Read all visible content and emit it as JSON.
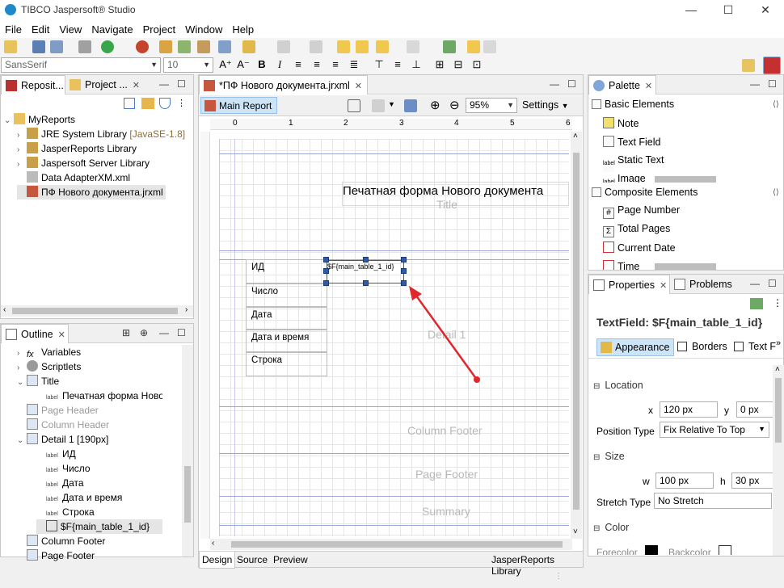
{
  "window": {
    "title": "TIBCO Jaspersoft® Studio",
    "min": "—",
    "max": "☐",
    "close": "✕"
  },
  "menu": [
    "File",
    "Edit",
    "View",
    "Navigate",
    "Project",
    "Window",
    "Help"
  ],
  "format": {
    "font": "SansSerif",
    "size": "10"
  },
  "repo": {
    "tab1": "Reposit...",
    "tab2": "Project ...",
    "root": "MyReports",
    "items": [
      {
        "label": "JRE System Library",
        "extra": "[JavaSE-1.8]"
      },
      {
        "label": "JasperReports Library",
        "extra": ""
      },
      {
        "label": "Jaspersoft Server Library",
        "extra": ""
      },
      {
        "label": "Data AdapterXM.xml",
        "extra": ""
      },
      {
        "label": "ПФ Нового документа.jrxml",
        "extra": ""
      }
    ]
  },
  "outline": {
    "tab": "Outline",
    "items": [
      {
        "label": "Variables",
        "icon": "fx"
      },
      {
        "label": "Scriptlets",
        "icon": "gear"
      },
      {
        "label": "Title",
        "icon": "band"
      },
      {
        "label": "Печатная форма Нового до",
        "icon": "label"
      },
      {
        "label": "Page Header",
        "icon": "band"
      },
      {
        "label": "Column Header",
        "icon": "band"
      },
      {
        "label": "Detail 1 [190px]",
        "icon": "band"
      },
      {
        "label": "ИД",
        "icon": "label"
      },
      {
        "label": "Число",
        "icon": "label"
      },
      {
        "label": "Дата",
        "icon": "label"
      },
      {
        "label": "Дата и время",
        "icon": "label"
      },
      {
        "label": "Строка",
        "icon": "label"
      },
      {
        "label": "$F{main_table_1_id}",
        "icon": "field"
      },
      {
        "label": "Column Footer",
        "icon": "band"
      },
      {
        "label": "Page Footer",
        "icon": "band"
      }
    ]
  },
  "editor": {
    "tab": "*ПФ Нового документа.jrxml",
    "subtab": "Main Report",
    "zoom": "95%",
    "settings": "Settings",
    "ruler": [
      "0",
      "1",
      "2",
      "3",
      "4",
      "5",
      "6"
    ],
    "title_text": "Печатная форма Нового документа",
    "bands": {
      "title": "Title",
      "detail": "Detail 1",
      "column_footer": "Column Footer",
      "page_footer": "Page Footer",
      "summary": "Summary"
    },
    "labels": [
      "ИД",
      "Число",
      "Дата",
      "Дата и время",
      "Строка"
    ],
    "field": "$F{main_table_1_id}",
    "bottom_tabs": [
      "Design",
      "Source",
      "Preview"
    ],
    "library": "JasperReports Library"
  },
  "palette": {
    "tab": "Palette",
    "basic": "Basic Elements",
    "basic_items": [
      "Note",
      "Text Field",
      "Static Text",
      "Image"
    ],
    "composite": "Composite Elements",
    "composite_items": [
      "Page Number",
      "Total Pages",
      "Current Date",
      "Time"
    ]
  },
  "props": {
    "tab": "Properties",
    "tab2": "Problems",
    "heading": "TextField: $F{main_table_1_id}",
    "subtabs": [
      "Appearance",
      "Borders",
      "Text F"
    ],
    "location": "Location",
    "x_label": "x",
    "x": "120 px",
    "y_label": "y",
    "y": "0 px",
    "pos_type_label": "Position Type",
    "pos_type": "Fix Relative To Top",
    "size": "Size",
    "w_label": "w",
    "w": "100 px",
    "h_label": "h",
    "h": "30 px",
    "stretch_label": "Stretch Type",
    "stretch": "No Stretch",
    "color": "Color",
    "forecolor": "Forecolor",
    "backcolor": "Backcolor"
  }
}
